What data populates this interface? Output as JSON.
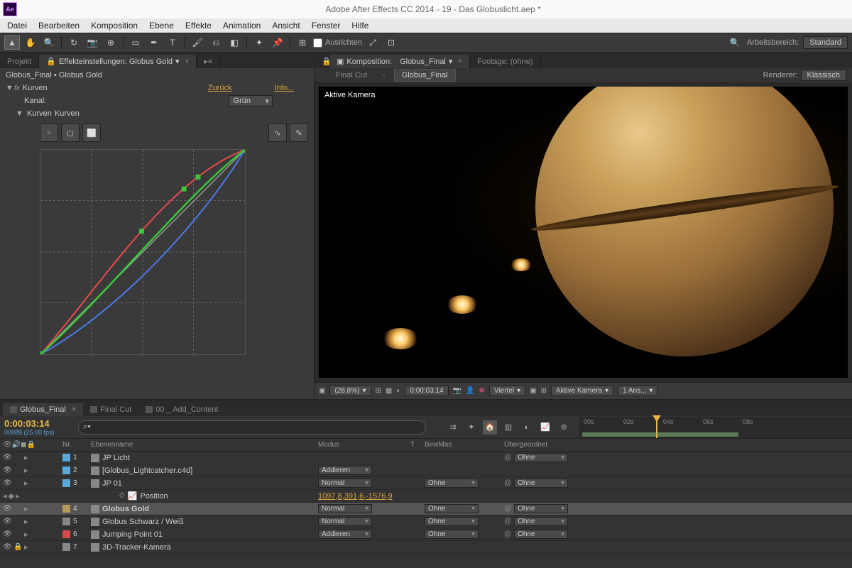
{
  "title": "Adobe After Effects CC 2014 - 19 - Das Globuslicht.aep *",
  "menus": [
    "Datei",
    "Bearbeiten",
    "Komposition",
    "Ebene",
    "Effekte",
    "Animation",
    "Ansicht",
    "Fenster",
    "Hilfe"
  ],
  "toolbar": {
    "align_label": "Ausrichten",
    "workspace_label": "Arbeitsbereich:",
    "workspace_value": "Standard"
  },
  "effects_panel": {
    "tabs": {
      "project": "Projekt",
      "effect_settings": "Effekteinstellungen: Globus Gold"
    },
    "breadcrumb": "Globus_Final • Globus Gold",
    "effect_name": "Kurven",
    "reset": "Zurück",
    "info": "Info...",
    "channel_label": "Kanal:",
    "channel_value": "Grün",
    "curves_label": "Kurven"
  },
  "comp_panel": {
    "tab_prefix": "Komposition:",
    "tab_comp": "Globus_Final",
    "tab_footage": "Footage: (ohne)",
    "subtab1": "Final Cut",
    "subtab2": "Globus_Final",
    "renderer_label": "Renderer:",
    "renderer_value": "Klassisch",
    "active_camera": "Aktive Kamera",
    "footer": {
      "zoom": "(28,8%)",
      "timecode": "0:00:03:14",
      "quality": "Viertel",
      "view": "Aktive Kamera",
      "views": "1 Ans..."
    }
  },
  "timeline": {
    "tabs": [
      "Globus_Final",
      "Final Cut",
      "00 _ Add_Content"
    ],
    "timecode": "0:00:03:14",
    "frames": "00089 (25.00 fps)",
    "search_placeholder": "",
    "ruler": [
      "00s",
      "02s",
      "04s",
      "06s",
      "08s"
    ],
    "cols": {
      "nr": "Nr.",
      "name": "Ebenenname",
      "mode": "Modus",
      "t": "T",
      "mask": "BewMas",
      "parent": "Übergeordnet"
    },
    "layers": [
      {
        "nr": "1",
        "color": "#5aa8d8",
        "name": "JP Licht",
        "mode": "",
        "mask": "",
        "parent": "Ohne"
      },
      {
        "nr": "2",
        "color": "#5aa8d8",
        "name": "[Globus_Lightcatcher.c4d]",
        "mode": "Addieren",
        "mask": "",
        "parent": ""
      },
      {
        "nr": "3",
        "color": "#5aa8d8",
        "name": "JP 01",
        "mode": "Normal",
        "mask": "Ohne",
        "parent": "Ohne",
        "expanded": true
      },
      {
        "nr": "4",
        "color": "#b89858",
        "name": "Globus Gold",
        "mode": "Normal",
        "mask": "Ohne",
        "parent": "Ohne",
        "selected": true
      },
      {
        "nr": "5",
        "color": "#888",
        "name": "Globus Schwarz / Weiß",
        "mode": "Normal",
        "mask": "Ohne",
        "parent": "Ohne"
      },
      {
        "nr": "6",
        "color": "#d84a4a",
        "name": "Jumping Point 01",
        "mode": "Addieren",
        "mask": "Ohne",
        "parent": "Ohne"
      },
      {
        "nr": "7",
        "color": "#888",
        "name": "3D-Tracker-Kamera",
        "mode": "",
        "mask": "",
        "parent": ""
      }
    ],
    "position_prop": {
      "label": "Position",
      "value": "1097,8,391,6,-1576,9"
    }
  }
}
